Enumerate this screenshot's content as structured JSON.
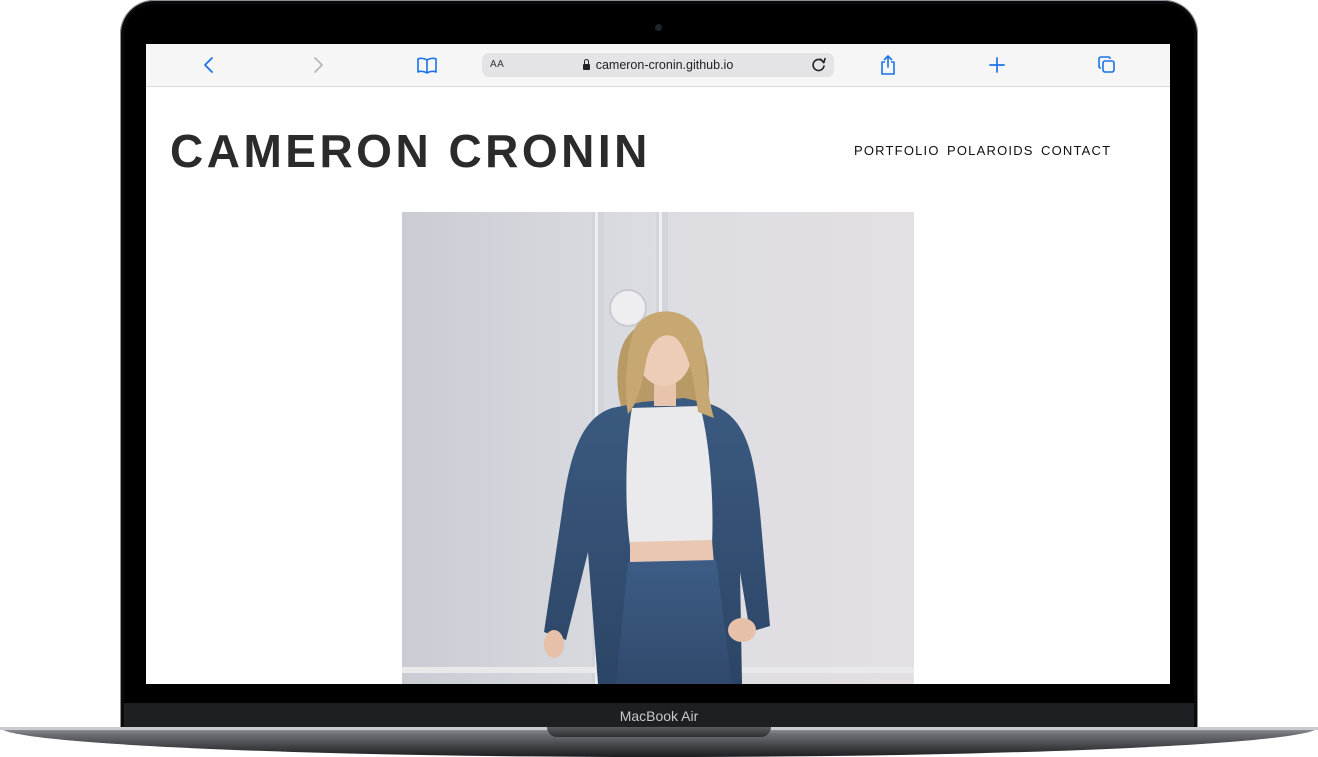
{
  "device": {
    "label": "MacBook Air"
  },
  "browser": {
    "text_size_label": "AA",
    "url": "cameron-cronin.github.io",
    "icons": [
      "back-icon",
      "forward-icon",
      "bookmarks-icon",
      "lock-icon",
      "reload-icon",
      "share-icon",
      "new-tab-icon",
      "tabs-icon"
    ],
    "accent": "#1a73e8"
  },
  "site": {
    "title": "CAMERON CRONIN",
    "nav": [
      "PORTFOLIO",
      "POLAROIDS",
      "CONTACT"
    ],
    "hero_image": "portrait-photo"
  }
}
